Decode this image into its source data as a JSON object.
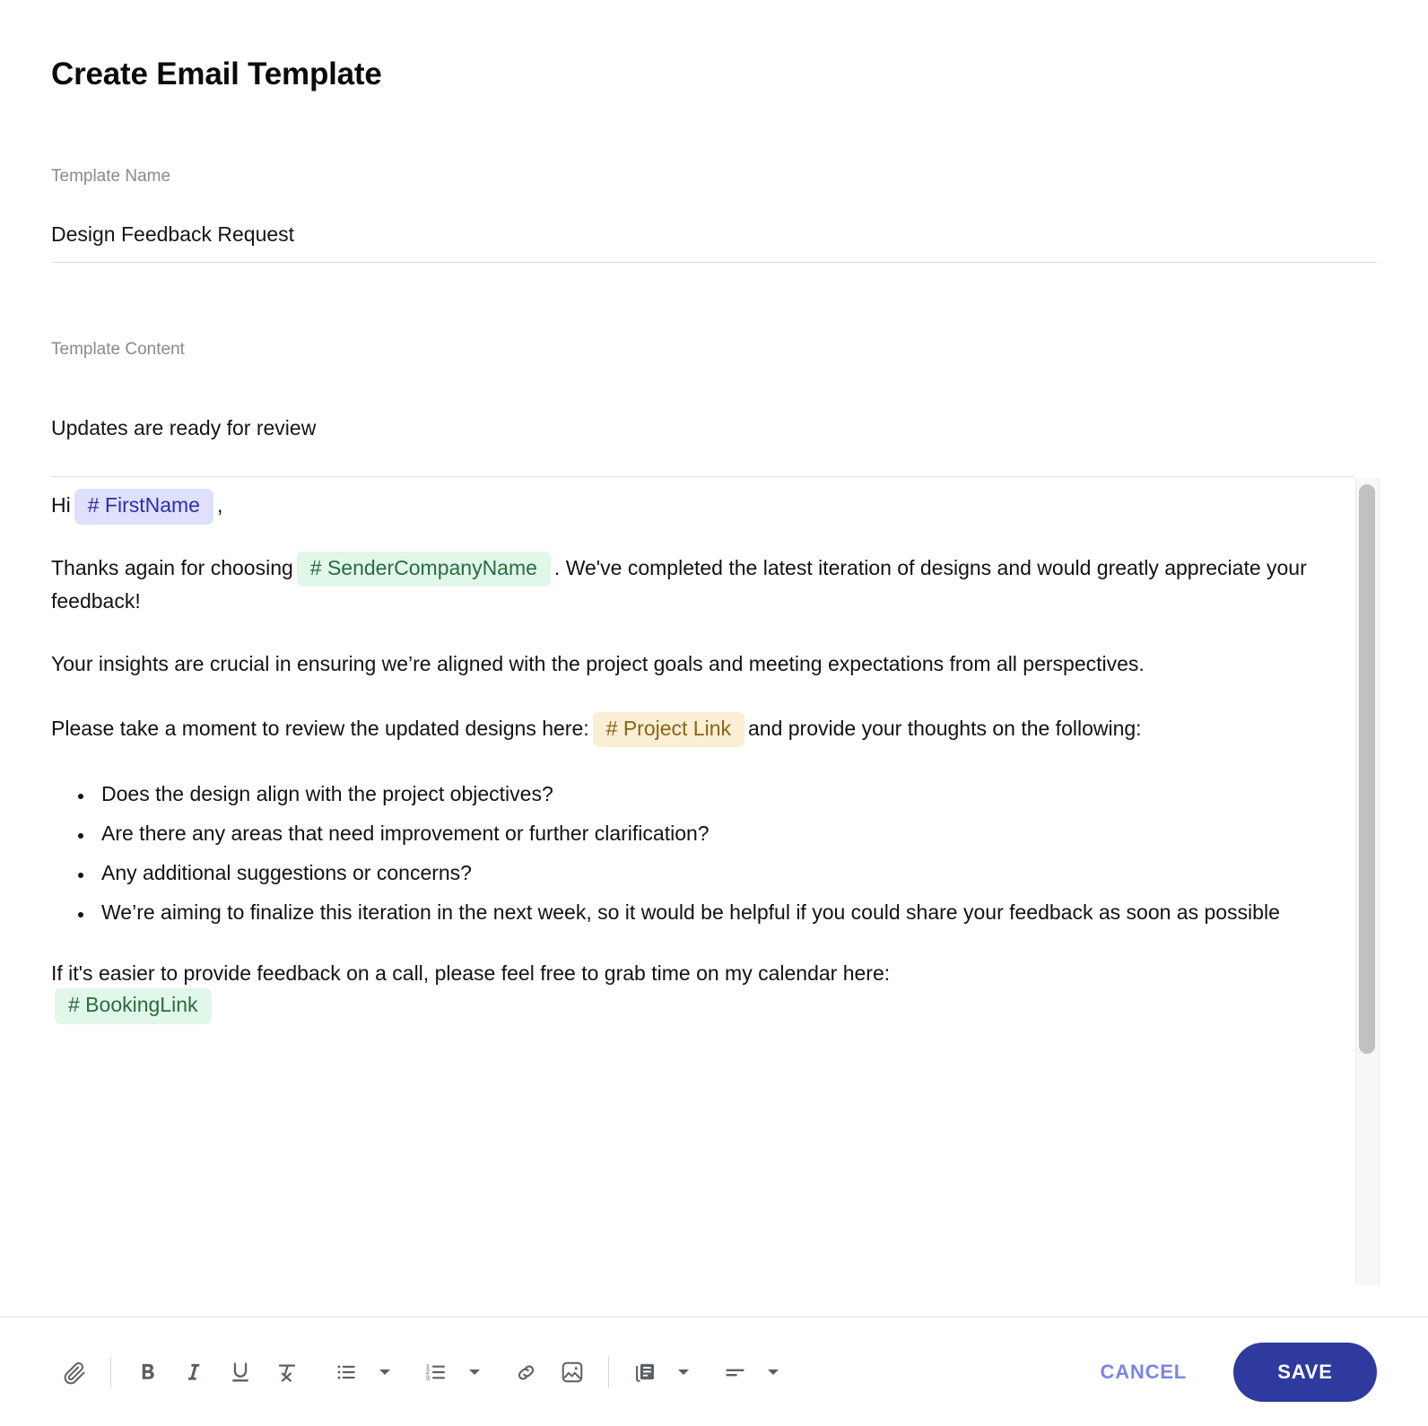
{
  "page": {
    "title": "Create Email Template"
  },
  "fields": {
    "template_name": {
      "label": "Template Name",
      "value": "Design Feedback Request"
    },
    "template_content": {
      "label": "Template Content",
      "subject": "Updates are ready for review"
    }
  },
  "editor": {
    "greeting": {
      "prefix": "Hi",
      "token": "# FirstName",
      "suffix": ","
    },
    "paragraph_1": {
      "before": "Thanks again for choosing",
      "token": "# SenderCompanyName",
      "after": ". We've completed the latest iteration of designs and would greatly appreciate your feedback!"
    },
    "paragraph_2": "Your insights are crucial in ensuring we’re aligned with the project goals and meeting expectations from all perspectives.",
    "paragraph_3": {
      "before": "Please take a moment to review the updated designs here:",
      "token": "# Project Link",
      "after": "and provide your thoughts on the following:"
    },
    "bullets": [
      "Does the design align with the project objectives?",
      "Are there any areas that need improvement or further clarification?",
      "Any additional suggestions or concerns?",
      "We’re aiming to finalize this iteration in the next week, so it would be helpful if you could share your feedback as soon as possible"
    ],
    "paragraph_4": {
      "before": "If it's easier to provide feedback on a call, please feel free to grab time on my calendar here:",
      "token": "# BookingLink"
    }
  },
  "toolbar": {
    "icons": [
      "attach-icon",
      "bold-icon",
      "italic-icon",
      "underline-icon",
      "clear-formatting-icon",
      "bulleted-list-icon",
      "numbered-list-icon",
      "link-icon",
      "image-icon",
      "template-icon",
      "horizontal-rule-icon"
    ],
    "cancel_label": "CANCEL",
    "save_label": "SAVE"
  },
  "colors": {
    "accent": "#2e3a9e",
    "cancel": "#7b85ea",
    "token_purple_bg": "#dfe0fb",
    "token_purple_fg": "#2b31a8",
    "token_green_bg": "#e0f7e9",
    "token_green_fg": "#2c6b3f",
    "token_amber_bg": "#faeed4",
    "token_amber_fg": "#8a6415"
  }
}
